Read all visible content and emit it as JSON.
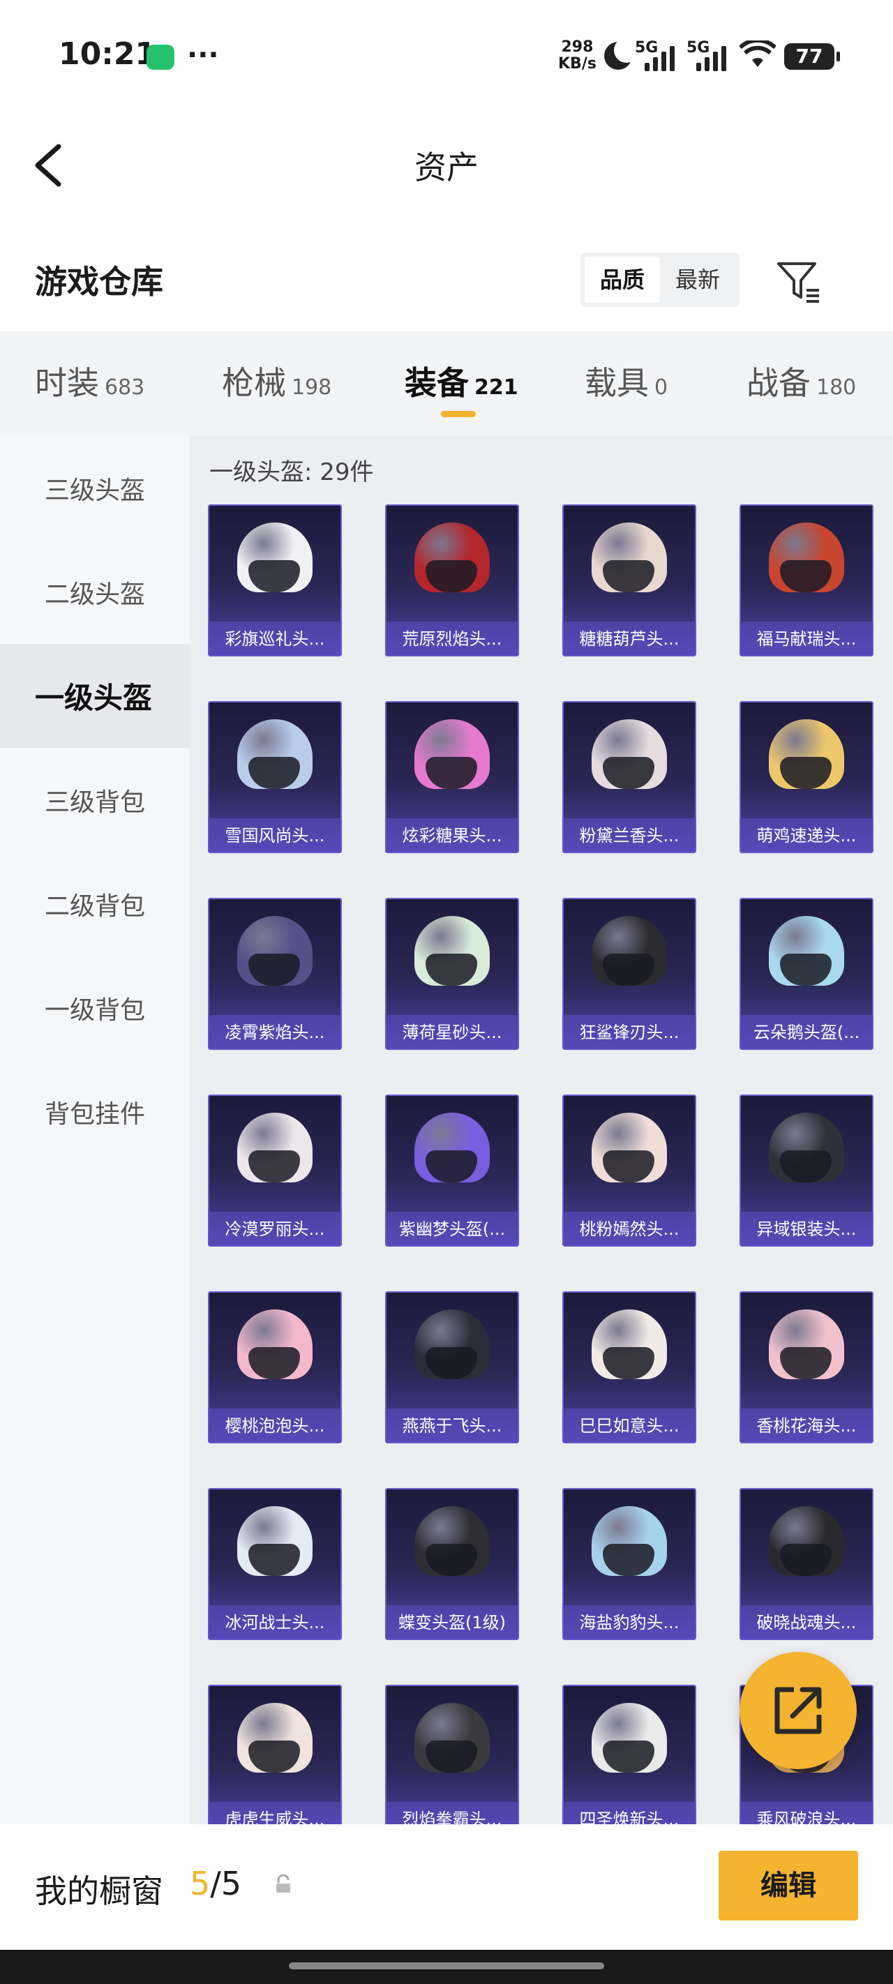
{
  "status_bar": {
    "time": "10:21",
    "dots": "···",
    "speed_value": "298",
    "speed_unit": "KB/s",
    "sim1": "5G",
    "sim2": "5G",
    "battery": "77"
  },
  "nav": {
    "title": "资产"
  },
  "warehouse": {
    "title": "游戏仓库",
    "sort_options": [
      "品质",
      "最新"
    ],
    "sort_selected": "品质"
  },
  "category_tabs": [
    {
      "label": "时装",
      "count": "683"
    },
    {
      "label": "枪械",
      "count": "198"
    },
    {
      "label": "装备",
      "count": "221",
      "active": true
    },
    {
      "label": "载具",
      "count": "0"
    },
    {
      "label": "战备",
      "count": "180"
    }
  ],
  "sidebar": {
    "items": [
      "三级头盔",
      "二级头盔",
      "一级头盔",
      "三级背包",
      "二级背包",
      "一级背包",
      "背包挂件"
    ],
    "active": "一级头盔"
  },
  "group": {
    "title": "一级头盔: 29件"
  },
  "items": [
    {
      "name": "彩旗巡礼头...",
      "color": "#f1f1f4"
    },
    {
      "name": "荒原烈焰头...",
      "color": "#b3262b"
    },
    {
      "name": "糖糖葫芦头...",
      "color": "#e9d8cf"
    },
    {
      "name": "福马献瑞头...",
      "color": "#c8452f"
    },
    {
      "name": "雪国风尚头...",
      "color": "#b9cdeb"
    },
    {
      "name": "炫彩糖果头...",
      "color": "#e57ad0"
    },
    {
      "name": "粉黛兰香头...",
      "color": "#e6dcdf"
    },
    {
      "name": "萌鸡速递头...",
      "color": "#eec66c"
    },
    {
      "name": "凌霄紫焰头...",
      "color": "#55508a"
    },
    {
      "name": "薄荷星砂头...",
      "color": "#d8ebd9"
    },
    {
      "name": "狂鲨锋刃头...",
      "color": "#2b2b31"
    },
    {
      "name": "云朵鹅头盔(...",
      "color": "#a9d9ef"
    },
    {
      "name": "冷漠罗丽头...",
      "color": "#ede6ec"
    },
    {
      "name": "紫幽梦头盔(...",
      "color": "#7a5ee0"
    },
    {
      "name": "桃粉嫣然头...",
      "color": "#f0ddd8"
    },
    {
      "name": "异域银装头...",
      "color": "#2c3238"
    },
    {
      "name": "樱桃泡泡头...",
      "color": "#f3b8cc"
    },
    {
      "name": "燕燕于飞头...",
      "color": "#2c2c3a"
    },
    {
      "name": "巳巳如意头...",
      "color": "#f2eae6"
    },
    {
      "name": "香桃花海头...",
      "color": "#f2c2cc"
    },
    {
      "name": "冰河战士头...",
      "color": "#e4ebf4"
    },
    {
      "name": "蝶变头盔(1级)",
      "color": "#2d2d33"
    },
    {
      "name": "海盐豹豹头...",
      "color": "#a6d2ec"
    },
    {
      "name": "破晓战魂头...",
      "color": "#2a2a2e"
    },
    {
      "name": "虎虎生威头...",
      "color": "#f0e4dc"
    },
    {
      "name": "烈焰拳霸头...",
      "color": "#3a3a3e"
    },
    {
      "name": "四圣焕新头...",
      "color": "#eaeaea"
    },
    {
      "name": "乘风破浪头...",
      "color": "#d9a15a"
    }
  ],
  "bottom_bar": {
    "label": "我的橱窗",
    "count_current": "5",
    "count_sep_total": "/5",
    "edit_label": "编辑"
  },
  "icons": {
    "back": "chevron-left-icon",
    "filter": "filter-icon",
    "share": "share-out-icon",
    "lock": "lock-icon"
  },
  "colors": {
    "accent": "#f2b22b",
    "card_bg": "#2b2756",
    "card_label": "#5e4ec8"
  }
}
